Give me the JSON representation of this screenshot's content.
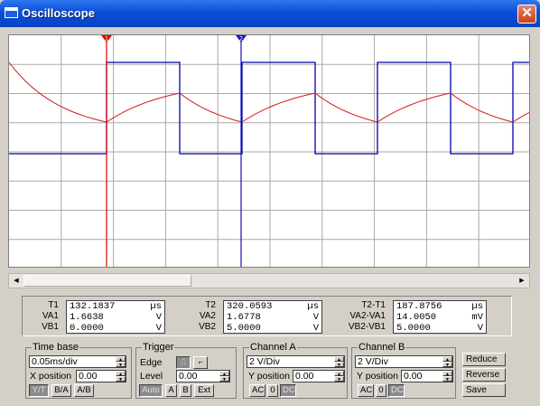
{
  "window": {
    "title": "Oscilloscope",
    "close_glyph": "✕"
  },
  "cursors": {
    "c1_label": "1",
    "c2_label": "2",
    "c1_color": "#e00000",
    "c2_color": "#1010c0"
  },
  "trace_colors": {
    "channel_a": "#d11a1a",
    "channel_b": "#0000b0"
  },
  "measurements": {
    "t1": {
      "label": "T1",
      "value": "132.1837",
      "unit": "µs"
    },
    "va1": {
      "label": "VA1",
      "value": "1.6638",
      "unit": "V"
    },
    "vb1": {
      "label": "VB1",
      "value": "0.0000",
      "unit": "V"
    },
    "t2": {
      "label": "T2",
      "value": "320.0593",
      "unit": "µs"
    },
    "va2": {
      "label": "VA2",
      "value": "1.6778",
      "unit": "V"
    },
    "vb2": {
      "label": "VB2",
      "value": "5.0000",
      "unit": "V"
    },
    "dt": {
      "label": "T2-T1",
      "value": "187.8756",
      "unit": "µs"
    },
    "dva": {
      "label": "VA2-VA1",
      "value": "14.0050",
      "unit": "mV"
    },
    "dvb": {
      "label": "VB2-VB1",
      "value": "5.0000",
      "unit": "V"
    }
  },
  "timebase": {
    "legend": "Time base",
    "value": "0.05ms/div",
    "xpos_label": "X position",
    "xpos_value": "0.00",
    "modes": [
      "Y/T",
      "B/A",
      "A/B"
    ]
  },
  "trigger": {
    "legend": "Trigger",
    "edge_label": "Edge",
    "level_label": "Level",
    "level_value": "0.00",
    "buttons": [
      "Auto",
      "A",
      "B",
      "Ext"
    ]
  },
  "channel_a": {
    "legend": "Channel A",
    "scale": "2 V/Div",
    "ypos_label": "Y position",
    "ypos_value": "0.00",
    "coupling": [
      "AC",
      "0",
      "DC"
    ]
  },
  "channel_b": {
    "legend": "Channel B",
    "scale": "2 V/Div",
    "ypos_label": "Y position",
    "ypos_value": "0.00",
    "coupling": [
      "AC",
      "0",
      "DC"
    ]
  },
  "side_buttons": [
    "Reduce",
    "Reverse",
    "Save"
  ]
}
